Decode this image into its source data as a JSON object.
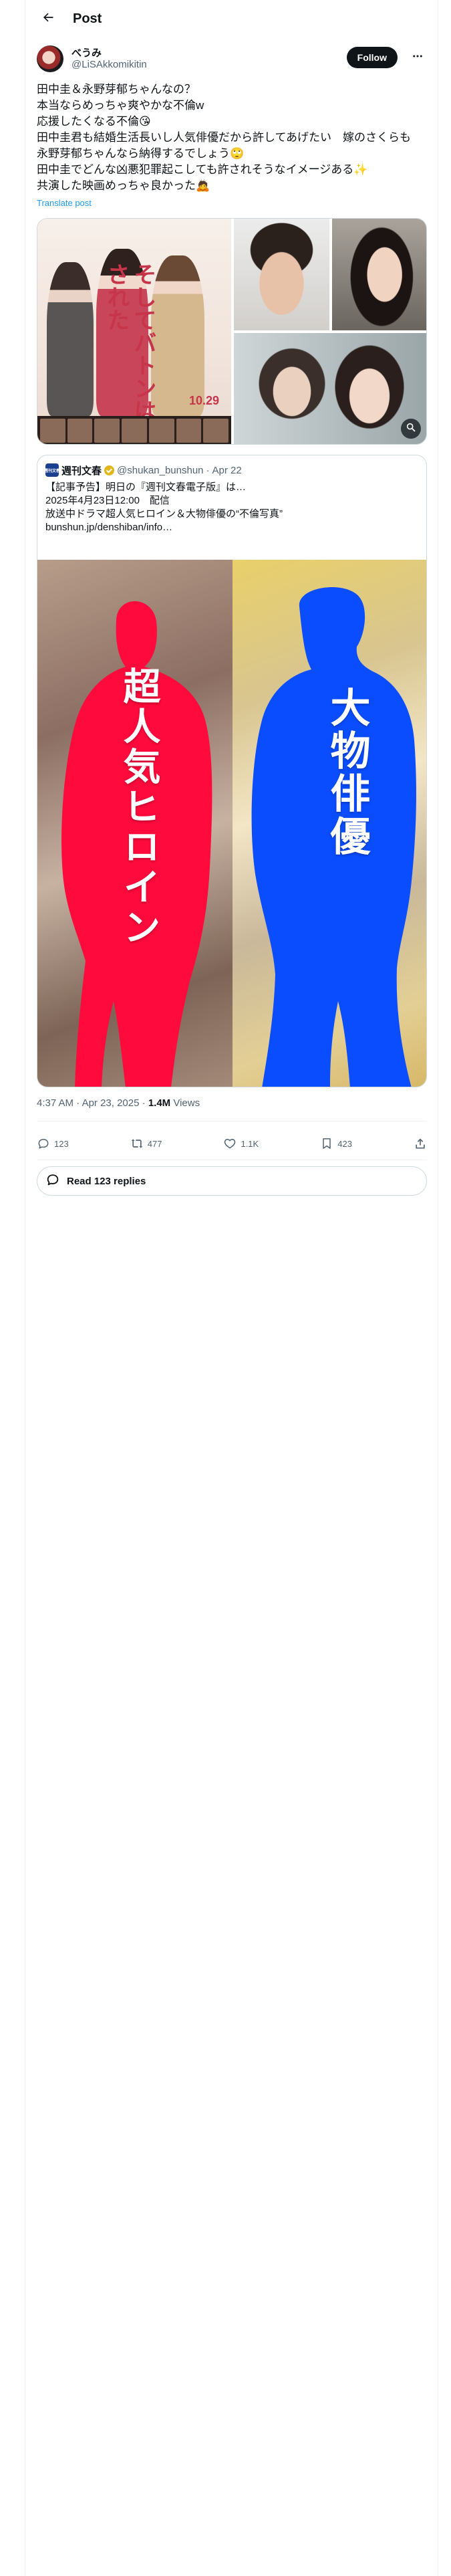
{
  "header": {
    "title": "Post"
  },
  "author": {
    "name": "べうみ",
    "handle": "@LiSAkkomikitin",
    "follow_label": "Follow"
  },
  "post": {
    "lines": [
      "田中圭＆永野芽郁ちゃんなの？",
      "本当ならめっちゃ爽やかな不倫w",
      "応援したくなる不倫😘",
      "田中圭君も結婚生活長いし人気俳優だから許してあげたい　嫁のさくらも",
      "永野芽郁ちゃんなら納得するでしょう🙄",
      "田中圭でどんな凶悪犯罪起こしても許されそうなイメージある✨",
      "共演した映画めっちゃ良かった🙇"
    ],
    "translate_label": "Translate post"
  },
  "media": {
    "poster_title": "そしてバトンは渡された",
    "poster_date": "10.29"
  },
  "quote": {
    "avatar_text": "週刊文春",
    "name": "週刊文春",
    "handle": "@shukan_bunshun",
    "separator": "·",
    "date": "Apr 22",
    "lines": [
      "【記事予告】明日の『週刊文春電子版』は…",
      "2025年4月23日12:00　配信",
      "",
      "放送中ドラマ超人気ヒロイン＆大物俳優の“不倫写真”",
      "bunshun.jp/denshiban/info…"
    ],
    "image_label_left": "超人気ヒロイン",
    "image_label_right": "大物俳優"
  },
  "meta": {
    "time": "4:37 AM",
    "separator": "·",
    "date": "Apr 23, 2025",
    "separator2": "·",
    "views": "1.4M",
    "views_label": "Views"
  },
  "actions": {
    "replies": "123",
    "reposts": "477",
    "likes": "1.1K",
    "bookmarks": "423"
  },
  "read_replies_label": "Read 123 replies",
  "colors": {
    "accent": "#1d9bf0",
    "silhouette_left": "#ff0a3c",
    "silhouette_right": "#0a4dff",
    "text_secondary": "#536471"
  }
}
